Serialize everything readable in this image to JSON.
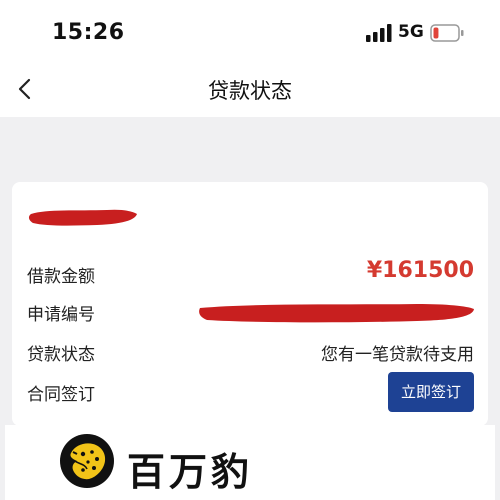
{
  "status_bar": {
    "time": "15:26",
    "network": "5G",
    "battery_level": 0.15,
    "battery_color": "#e0443a"
  },
  "nav": {
    "back_icon": "chevron-left-icon",
    "title": "贷款状态"
  },
  "card": {
    "rows": [
      {
        "label": "借款金额",
        "value": "¥161500"
      },
      {
        "label": "申请编号",
        "value": ""
      },
      {
        "label": "贷款状态",
        "value": "您有一笔贷款待支用"
      },
      {
        "label": "合同签订",
        "button": "立即签订"
      }
    ],
    "amount_color": "#d43a30",
    "button_color": "#1e4294",
    "redaction_color": "#c81f1f"
  },
  "brand": {
    "name": "百万豹",
    "logo_icon": "leopard-logo-icon"
  }
}
